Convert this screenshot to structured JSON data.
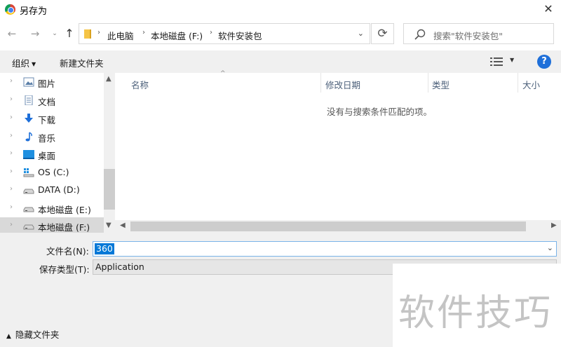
{
  "window": {
    "title": "另存为",
    "close_glyph": "✕"
  },
  "nav": {
    "back_glyph": "←",
    "forward_glyph": "→",
    "recent_glyph": "⌄",
    "up_glyph": "↑",
    "breadcrumbs": [
      "此电脑",
      "本地磁盘 (F:)",
      "软件安装包"
    ],
    "crumb_separator": "›",
    "dropdown_glyph": "⌄",
    "refresh_glyph": "⟳",
    "search_placeholder": "搜索\"软件安装包\""
  },
  "toolbar": {
    "organize_label": "组织",
    "organize_caret": "▼",
    "new_folder_label": "新建文件夹",
    "view_caret": "▼",
    "help_glyph": "?"
  },
  "tree": {
    "items": [
      {
        "label": "图片",
        "icon": "pictures-icon"
      },
      {
        "label": "文档",
        "icon": "documents-icon"
      },
      {
        "label": "下载",
        "icon": "downloads-icon"
      },
      {
        "label": "音乐",
        "icon": "music-icon"
      },
      {
        "label": "桌面",
        "icon": "desktop-icon"
      },
      {
        "label": "OS (C:)",
        "icon": "system-drive-icon"
      },
      {
        "label": "DATA (D:)",
        "icon": "drive-icon"
      },
      {
        "label": "本地磁盘 (E:)",
        "icon": "drive-icon"
      },
      {
        "label": "本地磁盘 (F:)",
        "icon": "drive-icon",
        "selected": true
      }
    ],
    "arrow_glyph": "›"
  },
  "filelist": {
    "columns": [
      "名称",
      "修改日期",
      "类型",
      "大小"
    ],
    "sort_glyph": "^",
    "empty_message": "没有与搜索条件匹配的项。"
  },
  "scroll": {
    "up": "▲",
    "down": "▼",
    "left": "◀",
    "right": "▶"
  },
  "form": {
    "filename_label": "文件名(N):",
    "filename_value": "360",
    "filetype_label": "保存类型(T):",
    "filetype_value": "Application",
    "dropdown_glyph": "⌄"
  },
  "footer": {
    "hide_folders_label": "隐藏文件夹",
    "hide_folders_chevron": "▲"
  },
  "watermark": {
    "text": "软件技巧"
  },
  "colors": {
    "accent": "#0078d7",
    "help": "#1e6fd9",
    "folder": "#f5c446",
    "selection": "#d9d9d9"
  }
}
